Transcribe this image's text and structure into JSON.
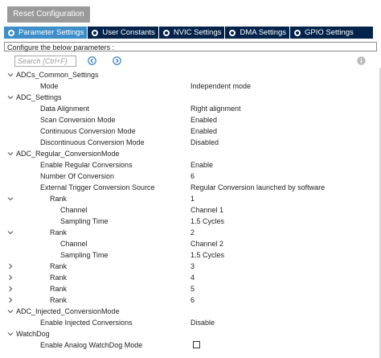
{
  "reset_button": "Reset Configuration",
  "tabs": [
    {
      "label": "Parameter Settings",
      "active": true
    },
    {
      "label": "User Constants",
      "active": false
    },
    {
      "label": "NVIC Settings",
      "active": false
    },
    {
      "label": "DMA Settings",
      "active": false
    },
    {
      "label": "GPIO Settings",
      "active": false
    }
  ],
  "hint": "Configure the below parameters :",
  "search": {
    "placeholder": "Search (Ctrl+F)"
  },
  "colors": {
    "tab_bar": "#03234b",
    "tab_active": "#3c8dc8",
    "nav_icon": "#1f6fc4",
    "info_icon": "#b9b9b9"
  },
  "icons": {
    "prev": "circle-chevron-left-icon",
    "next": "circle-chevron-right-icon",
    "info": "info-icon"
  },
  "tree": [
    {
      "label": "ADCs_Common_Settings",
      "expander": "expanded",
      "level": 0
    },
    {
      "label": "Mode",
      "value": "Independent mode",
      "level": 2
    },
    {
      "label": "ADC_Settings",
      "expander": "expanded",
      "level": 0
    },
    {
      "label": "Data Alignment",
      "value": "Right alignment",
      "level": 2
    },
    {
      "label": "Scan Conversion Mode",
      "value": "Enabled",
      "level": 2
    },
    {
      "label": "Continuous Conversion Mode",
      "value": "Enabled",
      "level": 2
    },
    {
      "label": "Discontinuous Conversion Mode",
      "value": "Disabled",
      "level": 2
    },
    {
      "label": "ADC_Regular_ConversionMode",
      "expander": "expanded",
      "level": 0
    },
    {
      "label": "Enable Regular Conversions",
      "value": "Enable",
      "level": 2
    },
    {
      "label": "Number Of Conversion",
      "value": "6",
      "level": 2
    },
    {
      "label": "External Trigger Conversion Source",
      "value": "Regular Conversion launched by software",
      "level": 2
    },
    {
      "label": "Rank",
      "value": "1",
      "expander": "expanded",
      "level": 3
    },
    {
      "label": "Channel",
      "value": "Channel 1",
      "level": 4
    },
    {
      "label": "Sampling Time",
      "value": "1.5 Cycles",
      "level": 4
    },
    {
      "label": "Rank",
      "value": "2",
      "expander": "expanded",
      "level": 3
    },
    {
      "label": "Channel",
      "value": "Channel 2",
      "level": 4
    },
    {
      "label": "Sampling Time",
      "value": "1.5 Cycles",
      "level": 4
    },
    {
      "label": "Rank",
      "value": "3",
      "expander": "collapsed",
      "level": 3
    },
    {
      "label": "Rank",
      "value": "4",
      "expander": "collapsed",
      "level": 3
    },
    {
      "label": "Rank",
      "value": "5",
      "expander": "collapsed",
      "level": 3
    },
    {
      "label": "Rank",
      "value": "6",
      "expander": "collapsed",
      "level": 3
    },
    {
      "label": "ADC_Injected_ConversionMode",
      "expander": "expanded",
      "level": 0
    },
    {
      "label": "Enable Injected Conversions",
      "value": "Disable",
      "level": 2
    },
    {
      "label": "WatchDog",
      "expander": "expanded",
      "level": 0
    },
    {
      "label": "Enable Analog WatchDog Mode",
      "checkbox": false,
      "level": 2
    }
  ]
}
